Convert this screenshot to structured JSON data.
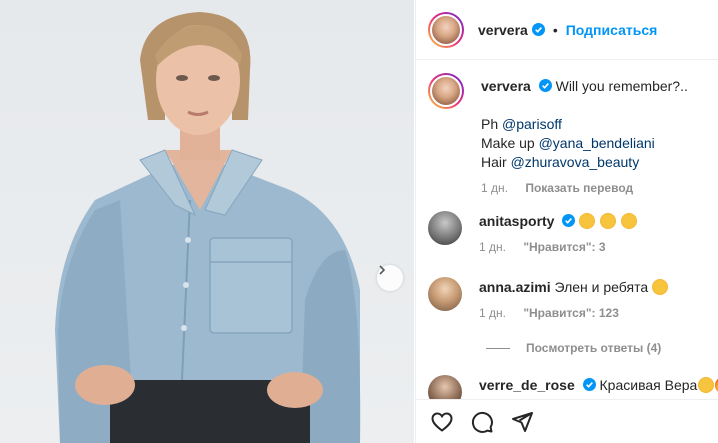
{
  "post": {
    "author": "ververa",
    "follow_label": "Подписаться",
    "separator": "•"
  },
  "caption": {
    "username": "ververa",
    "text": "Will you remember?..",
    "credits": [
      {
        "prefix": "Ph",
        "mention": "@parisoff"
      },
      {
        "prefix": "Make up",
        "mention": "@yana_bendeliani"
      },
      {
        "prefix": "Hair",
        "mention": "@zhuravova_beauty"
      }
    ],
    "time": "1 дн.",
    "translate_label": "Показать перевод"
  },
  "comments": [
    {
      "username": "anitasporty",
      "text": "",
      "emoji": [
        "star-struck",
        "star-struck",
        "star-struck"
      ],
      "time": "1 дн.",
      "likes": "\"Нравится\": 3"
    },
    {
      "username": "anna.azimi",
      "text": "Элен и ребята",
      "emoji": [
        "star-struck"
      ],
      "time": "1 дн.",
      "likes": "\"Нравится\": 123"
    },
    {
      "username": "verre_de_rose",
      "text": "Красивая Вера",
      "emoji": [
        "star-struck",
        "fire"
      ],
      "time": "",
      "likes": ""
    }
  ],
  "view_replies_label": "Посмотреть ответы (4)",
  "icons": {
    "verified": "verified-badge-icon",
    "next": "chevron-right-icon",
    "like": "heart-icon",
    "comment": "comment-bubble-icon",
    "share": "paper-plane-icon"
  },
  "colors": {
    "link": "#0095f6",
    "mention": "#00376b",
    "muted": "#8e8e8e",
    "text": "#262626"
  }
}
